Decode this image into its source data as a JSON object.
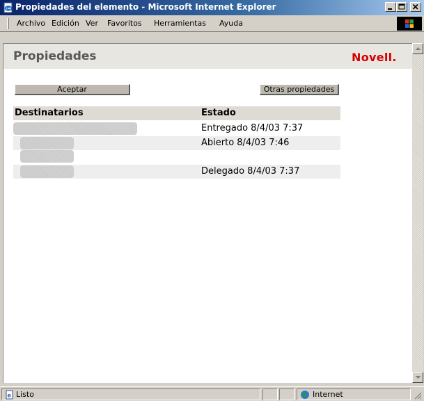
{
  "window": {
    "title": "Propiedades del elemento - Microsoft Internet Explorer",
    "icon": "ie-page-icon",
    "controls": [
      "minimize",
      "maximize",
      "close"
    ]
  },
  "menu": {
    "items": [
      "Archivo",
      "Edición",
      "Ver",
      "Favoritos",
      "Herramientas",
      "Ayuda"
    ]
  },
  "page": {
    "title": "Propiedades",
    "logo": "Novell.",
    "accept_button": "Aceptar",
    "other_props_button": "Otras propiedades"
  },
  "table": {
    "headers": [
      "Destinatarios",
      "Estado"
    ],
    "rows": [
      {
        "recipient": "",
        "status": "Entregado 8/4/03 7:37"
      },
      {
        "recipient": "",
        "status": "Abierto 8/4/03 7:46"
      },
      {
        "recipient": "",
        "status": ""
      },
      {
        "recipient": "",
        "status": "Delegado 8/4/03 7:37"
      }
    ]
  },
  "statusbar": {
    "left": "Listo",
    "zone": "Internet"
  },
  "colors": {
    "titlebar_start": "#0a246a",
    "titlebar_end": "#a6caf0",
    "logo": "#d40000",
    "chrome": "#d4d0c8"
  }
}
